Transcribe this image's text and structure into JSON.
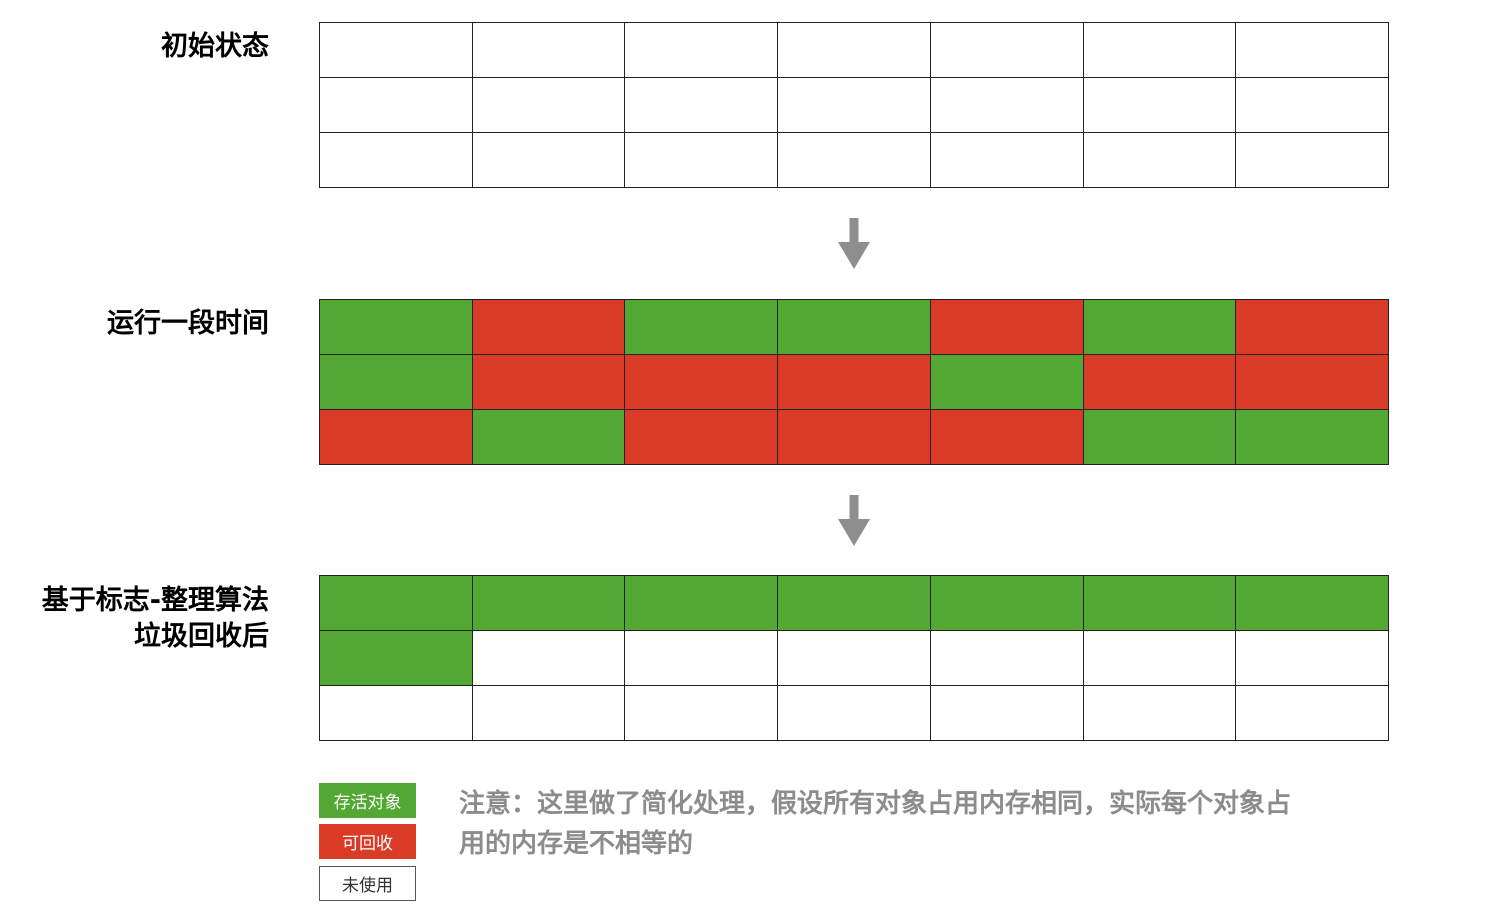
{
  "colors": {
    "alive": "#52a833",
    "reclaimable": "#d93b26",
    "unused": "#ffffff",
    "arrow": "#8e8e8e",
    "note_text": "#8c8c8c"
  },
  "stages": [
    {
      "label_lines": [
        "初始状态"
      ],
      "cells": [
        [
          "unused",
          "unused",
          "unused",
          "unused",
          "unused",
          "unused",
          "unused"
        ],
        [
          "unused",
          "unused",
          "unused",
          "unused",
          "unused",
          "unused",
          "unused"
        ],
        [
          "unused",
          "unused",
          "unused",
          "unused",
          "unused",
          "unused",
          "unused"
        ]
      ]
    },
    {
      "label_lines": [
        "运行一段时间"
      ],
      "cells": [
        [
          "alive",
          "reclaimable",
          "alive",
          "alive",
          "reclaimable",
          "alive",
          "reclaimable"
        ],
        [
          "alive",
          "reclaimable",
          "reclaimable",
          "reclaimable",
          "alive",
          "reclaimable",
          "reclaimable"
        ],
        [
          "reclaimable",
          "alive",
          "reclaimable",
          "reclaimable",
          "reclaimable",
          "alive",
          "alive"
        ]
      ]
    },
    {
      "label_lines": [
        "基于标志-整理算法",
        "垃圾回收后"
      ],
      "cells": [
        [
          "alive",
          "alive",
          "alive",
          "alive",
          "alive",
          "alive",
          "alive"
        ],
        [
          "alive",
          "unused",
          "unused",
          "unused",
          "unused",
          "unused",
          "unused"
        ],
        [
          "unused",
          "unused",
          "unused",
          "unused",
          "unused",
          "unused",
          "unused"
        ]
      ]
    }
  ],
  "legend": [
    {
      "key": "alive",
      "label": "存活对象"
    },
    {
      "key": "reclaimable",
      "label": "可回收"
    },
    {
      "key": "unused",
      "label": "未使用"
    }
  ],
  "note": {
    "line1": "注意：这里做了简化处理，假设所有对象占用内存相同，实际每个对象占",
    "line2": "用的内存是不相等的"
  }
}
